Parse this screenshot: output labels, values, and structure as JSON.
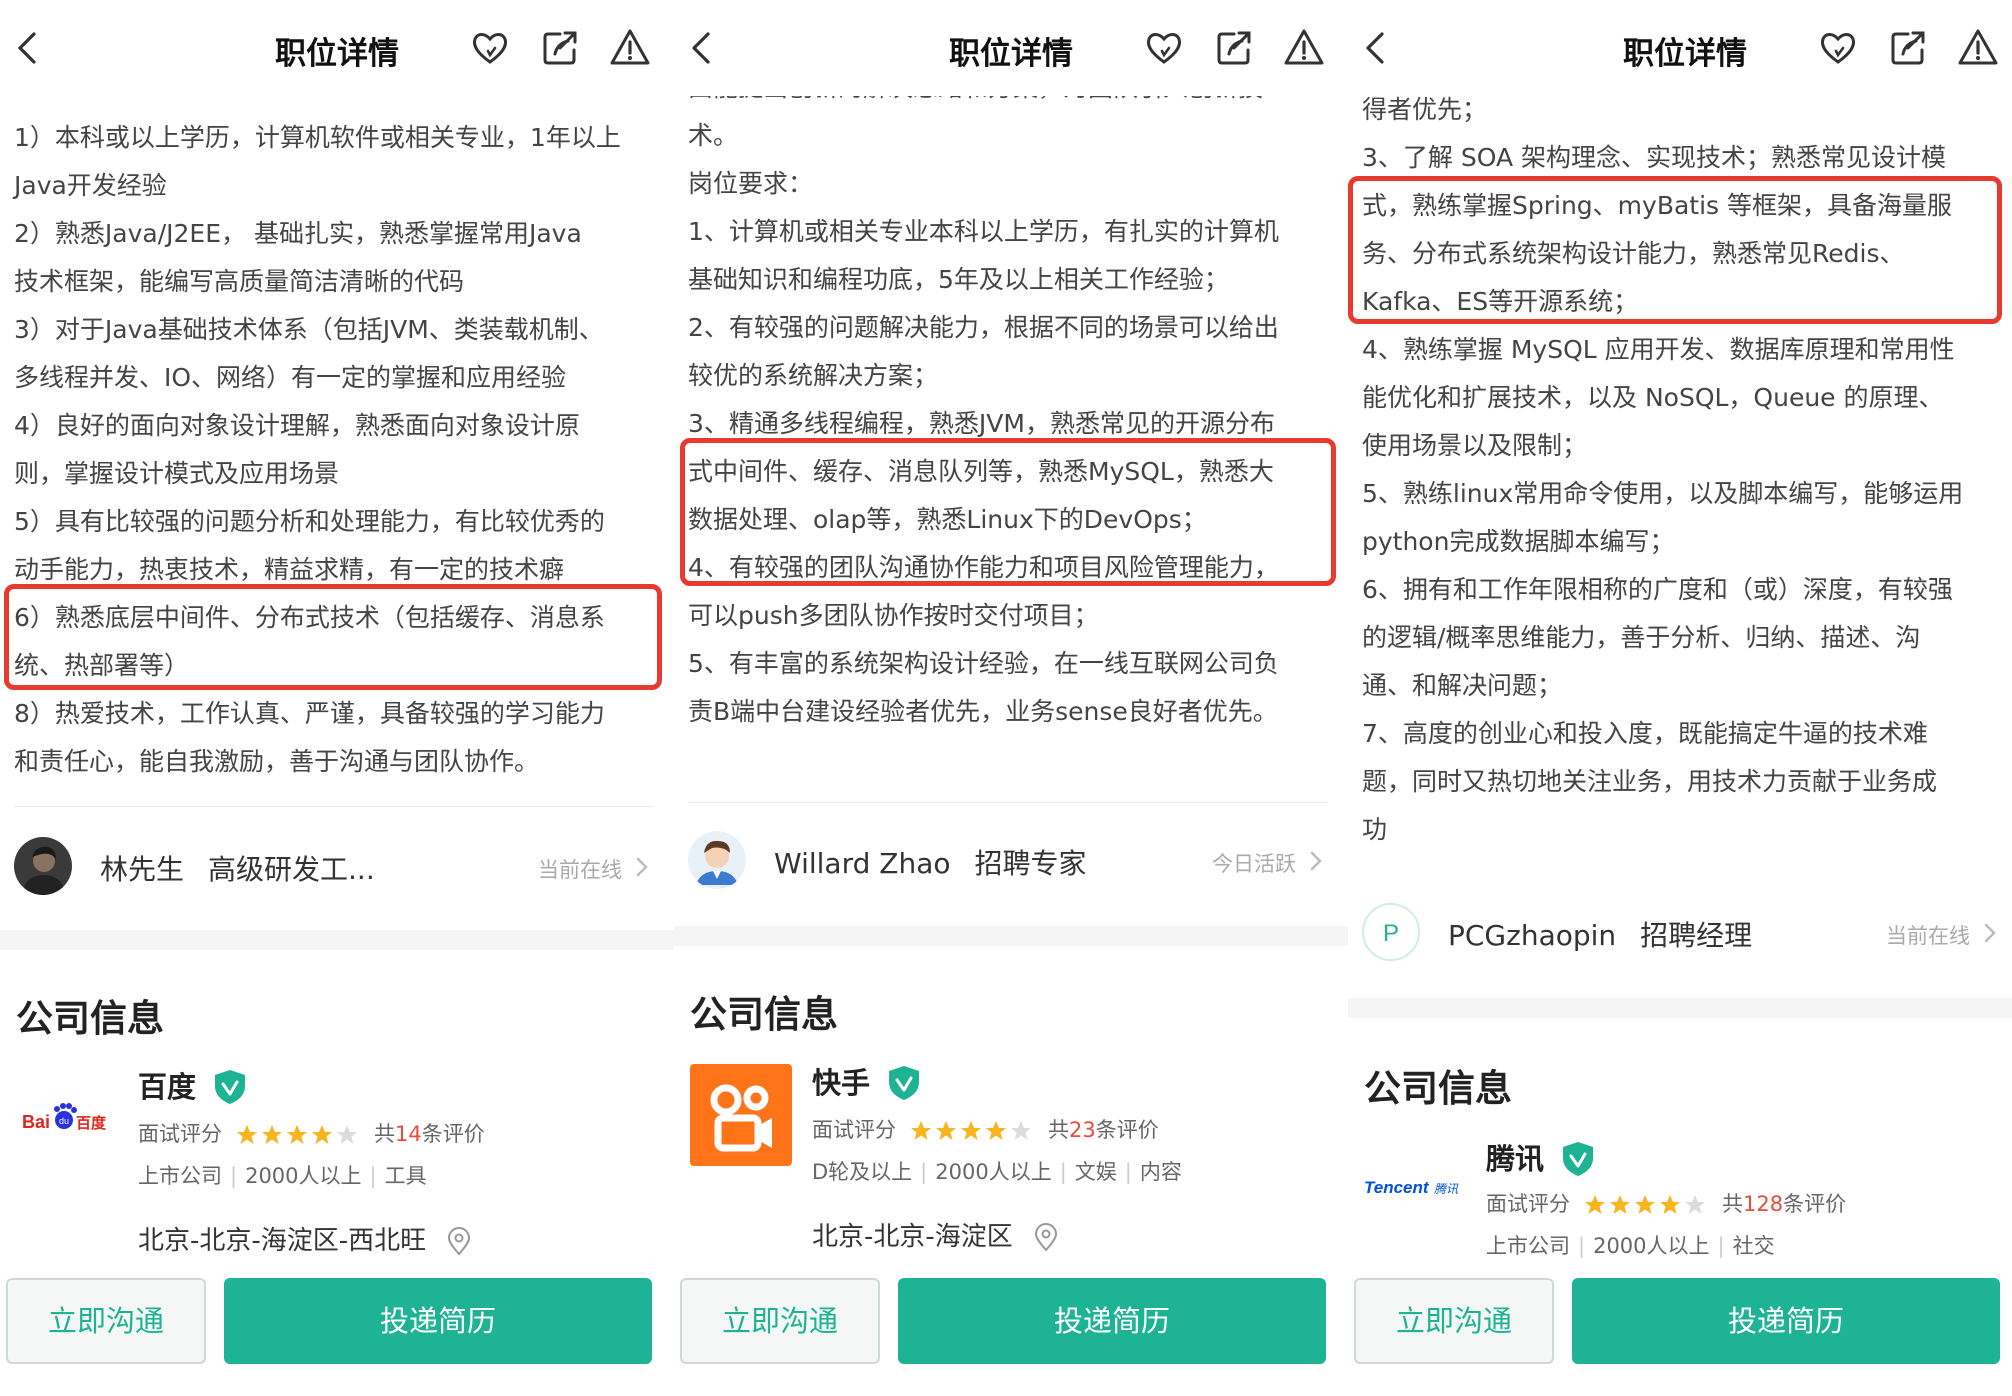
{
  "colors": {
    "accent": "#1eb394",
    "highlight_box": "#e63b2e",
    "count": "#e84d3a"
  },
  "icons": [
    "back-arrow-icon",
    "heart-icon",
    "share-icon",
    "warning-icon",
    "chevron-right-icon",
    "verified-badge-icon",
    "location-pin-icon",
    "star-icon"
  ],
  "panels": [
    {
      "header": {
        "title": "职位详情"
      },
      "description": [
        "1）本科或以上学历，计算机软件或相关专业，1年以上",
        "Java开发经验",
        "2）熟悉Java/J2EE， 基础扎实，熟悉掌握常用Java",
        "技术框架，能编写高质量简洁清晰的代码",
        "3）对于Java基础技术体系（包括JVM、类装载机制、",
        "多线程并发、IO、网络）有一定的掌握和应用经验",
        "4）良好的面向对象设计理解，熟悉面向对象设计原",
        "则，掌握设计模式及应用场景",
        "5）具有比较强的问题分析和处理能力，有比较优秀的",
        "动手能力，热衷技术，精益求精，有一定的技术癖",
        "6）熟悉底层中间件、分布式技术（包括缓存、消息系",
        "统、热部署等）",
        "8）热爱技术，工作认真、严谨，具备较强的学习能力",
        "和责任心，能自我激励，善于沟通与团队协作。"
      ],
      "recruiter": {
        "name": "林先生",
        "role": "高级研发工...",
        "status": "当前在线"
      },
      "company": {
        "section_title": "公司信息",
        "name": "百度",
        "rating_label": "面试评分",
        "rating": 4,
        "reviews_prefix": "共",
        "reviews_count": "14",
        "reviews_suffix": "条评价",
        "meta": [
          "上市公司",
          "2000人以上",
          "工具"
        ],
        "address": "北京-北京-海淀区-西北旺",
        "logo_text": "Bai百度"
      },
      "buttons": {
        "chat": "立即沟通",
        "apply": "投递简历"
      }
    },
    {
      "header": {
        "title": "职位详情"
      },
      "description": [
        "面能提出创新的解决思路和方案，为团队引入创新技",
        "术。",
        "岗位要求：",
        "1、计算机或相关专业本科以上学历，有扎实的计算机",
        "基础知识和编程功底，5年及以上相关工作经验；",
        "2、有较强的问题解决能力，根据不同的场景可以给出",
        "较优的系统解决方案；",
        "3、精通多线程编程，熟悉JVM，熟悉常见的开源分布",
        "式中间件、缓存、消息队列等，熟悉MySQL，熟悉大",
        "数据处理、olap等，熟悉Linux下的DevOps；",
        "4、有较强的团队沟通协作能力和项目风险管理能力，",
        "可以push多团队协作按时交付项目；",
        "5、有丰富的系统架构设计经验，在一线互联网公司负",
        "责B端中台建设经验者优先，业务sense良好者优先。"
      ],
      "recruiter": {
        "name": "Willard Zhao",
        "role": "招聘专家",
        "status": "今日活跃"
      },
      "company": {
        "section_title": "公司信息",
        "name": "快手",
        "rating_label": "面试评分",
        "rating": 4,
        "reviews_prefix": "共",
        "reviews_count": "23",
        "reviews_suffix": "条评价",
        "meta": [
          "D轮及以上",
          "2000人以上",
          "文娱",
          "内容"
        ],
        "address": "北京-北京-海淀区"
      },
      "buttons": {
        "chat": "立即沟通",
        "apply": "投递简历"
      }
    },
    {
      "header": {
        "title": "职位详情"
      },
      "description": [
        "得者优先；",
        "3、了解 SOA 架构理念、实现技术；熟悉常见设计模",
        "式，熟练掌握Spring、myBatis 等框架，具备海量服",
        "务、分布式系统架构设计能力，熟悉常见Redis、",
        "Kafka、ES等开源系统；",
        "4、熟练掌握 MySQL 应用开发、数据库原理和常用性",
        "能优化和扩展技术，以及 NoSQL，Queue 的原理、",
        "使用场景以及限制；",
        "5、熟练linux常用命令使用，以及脚本编写，能够运用",
        "python完成数据脚本编写；",
        "6、拥有和工作年限相称的广度和（或）深度，有较强",
        "的逻辑/概率思维能力，善于分析、归纳、描述、沟",
        "通、和解决问题；",
        "7、高度的创业心和投入度，既能搞定牛逼的技术难",
        "题，同时又热切地关注业务，用技术力贡献于业务成",
        "功"
      ],
      "recruiter": {
        "name": "PCGzhaopin",
        "role": "招聘经理",
        "status": "当前在线",
        "avatar_letter": "P"
      },
      "company": {
        "section_title": "公司信息",
        "name": "腾讯",
        "rating_label": "面试评分",
        "rating": 4,
        "reviews_prefix": "共",
        "reviews_count": "128",
        "reviews_suffix": "条评价",
        "meta": [
          "上市公司",
          "2000人以上",
          "社交"
        ],
        "logo_text": "Tencent腾讯"
      },
      "buttons": {
        "chat": "立即沟通",
        "apply": "投递简历"
      }
    }
  ]
}
